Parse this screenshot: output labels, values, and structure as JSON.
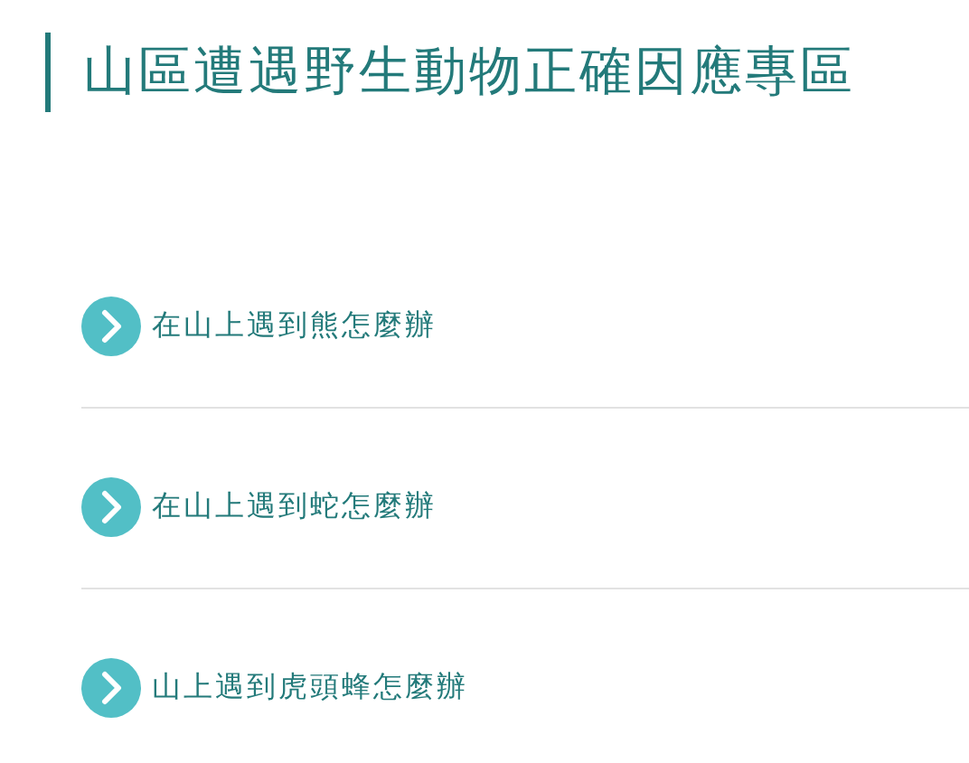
{
  "title": "山區遭遇野生動物正確因應專區",
  "links": [
    {
      "label": "在山上遇到熊怎麼辦"
    },
    {
      "label": "在山上遇到蛇怎麼辦"
    },
    {
      "label": "山上遇到虎頭蜂怎麼辦"
    }
  ]
}
